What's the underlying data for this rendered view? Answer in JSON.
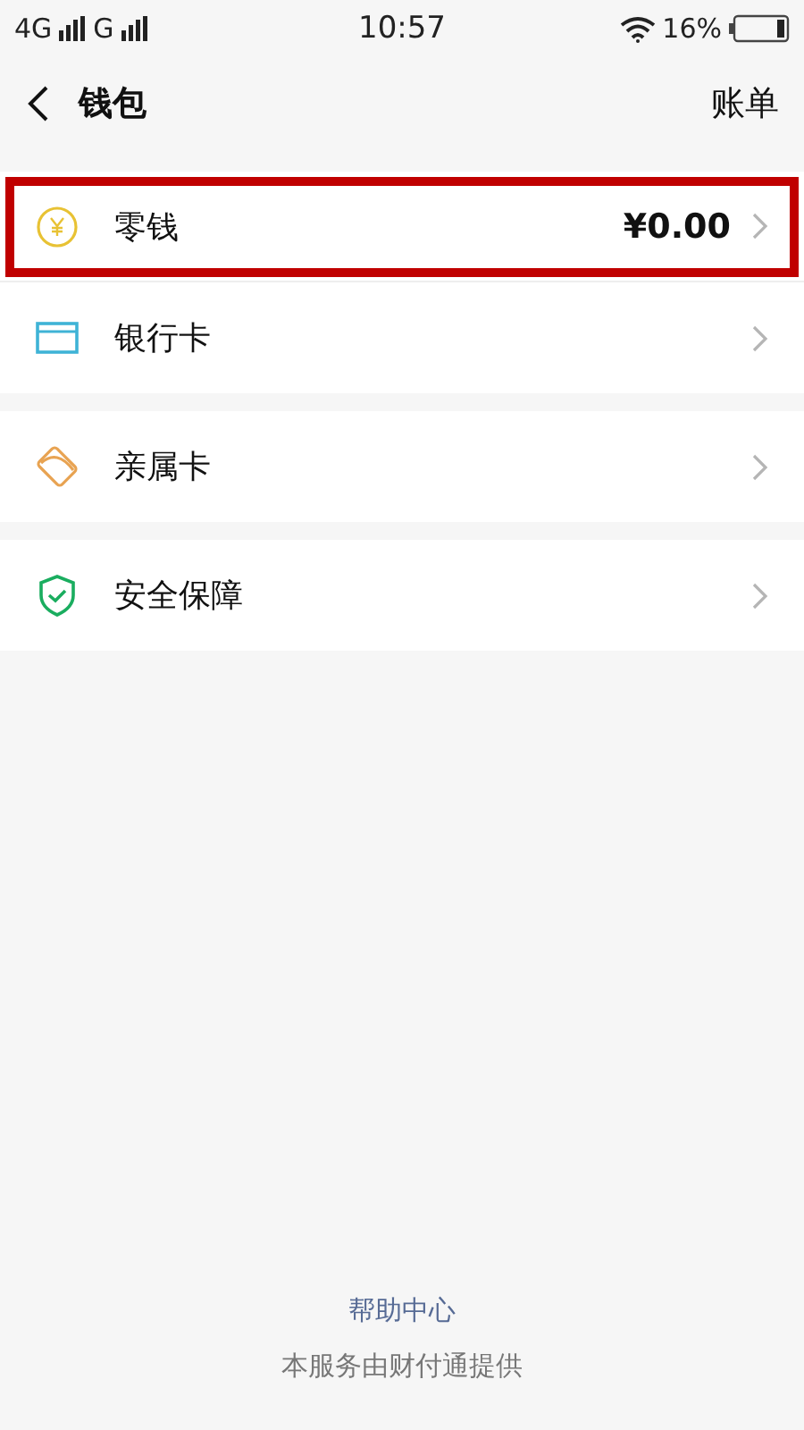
{
  "status_bar": {
    "network_1": "4G",
    "network_2": "G",
    "time": "10:57",
    "battery": "16%"
  },
  "nav": {
    "title": "钱包",
    "action": "账单"
  },
  "groups": [
    {
      "items": [
        {
          "kind": "coin",
          "label": "零钱",
          "value": "¥0.00",
          "highlighted": true
        },
        {
          "kind": "card",
          "label": "银行卡",
          "highlighted": false
        }
      ]
    },
    {
      "items": [
        {
          "kind": "family",
          "label": "亲属卡",
          "highlighted": false
        }
      ]
    },
    {
      "items": [
        {
          "kind": "shield",
          "label": "安全保障",
          "highlighted": false
        }
      ]
    }
  ],
  "footer": {
    "link": "帮助中心",
    "note": "本服务由财付通提供"
  }
}
